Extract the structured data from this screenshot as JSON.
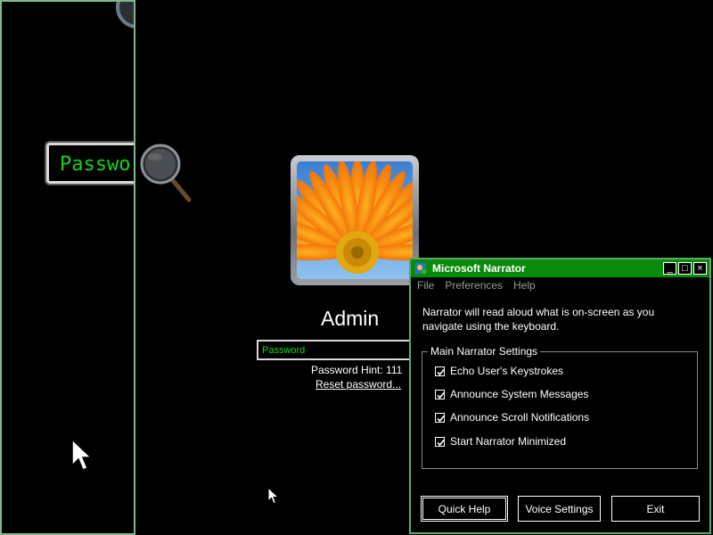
{
  "magnifier": {
    "zoomed_field_text": "Passwo"
  },
  "login": {
    "username": "Admin",
    "password_placeholder": "Password",
    "password_hint": "Password Hint: 111",
    "reset_link": "Reset password..."
  },
  "narrator": {
    "title": "Microsoft Narrator",
    "window_buttons": {
      "minimize": "_",
      "maximize": "□",
      "close": "×"
    },
    "menu": [
      "File",
      "Preferences",
      "Help"
    ],
    "description": "Narrator will read aloud what is on-screen as you navigate using the keyboard.",
    "settings_group_label": "Main Narrator Settings",
    "settings": [
      {
        "label": "Echo User's Keystrokes",
        "checked": true
      },
      {
        "label": "Announce System Messages",
        "checked": true
      },
      {
        "label": "Announce Scroll Notifications",
        "checked": true
      },
      {
        "label": "Start Narrator Minimized",
        "checked": true
      }
    ],
    "buttons": {
      "quick_help": "Quick Help",
      "voice_settings": "Voice Settings",
      "exit": "Exit"
    }
  },
  "colors": {
    "background": "#000000",
    "titlebar": "#0a8a0a",
    "input_text": "#19d219",
    "magnifier_border": "#7fb88f"
  }
}
